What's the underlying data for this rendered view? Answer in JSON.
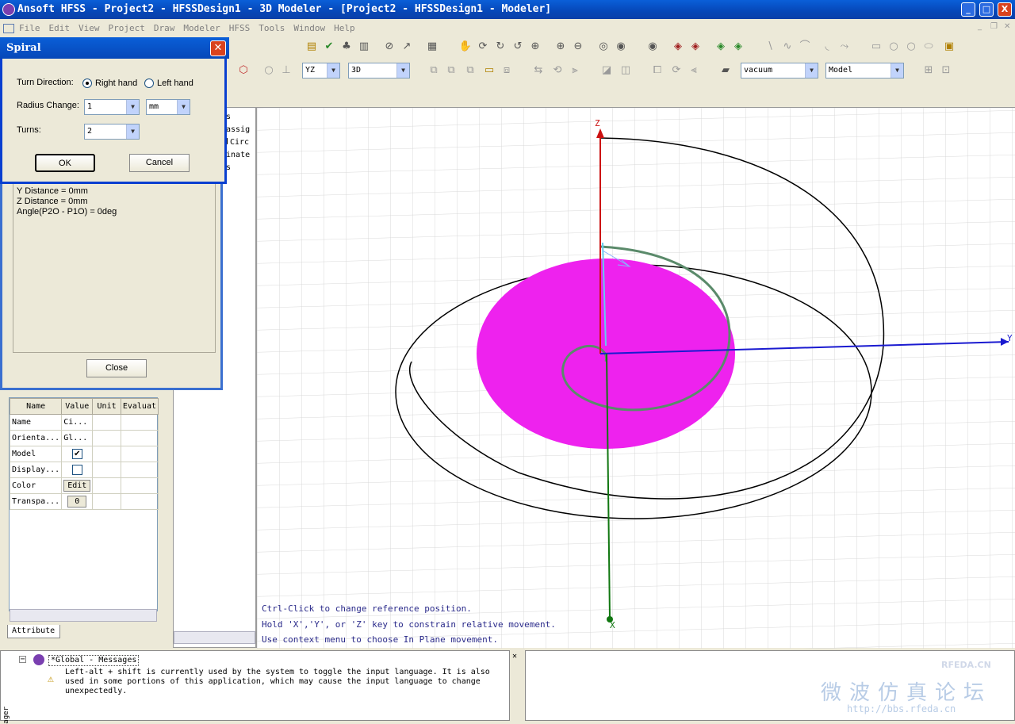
{
  "window": {
    "title": "Ansoft HFSS - Project2 - HFSSDesign1 - 3D Modeler - [Project2 - HFSSDesign1 - Modeler]",
    "minimize": "_",
    "maximize": "□",
    "close": "X"
  },
  "menu": [
    "File",
    "Edit",
    "View",
    "Project",
    "Draw",
    "Modeler",
    "HFSS",
    "Tools",
    "Window",
    "Help"
  ],
  "toolbar": {
    "plane": "YZ",
    "dimension": "3D",
    "material": "vacuum",
    "mode": "Model"
  },
  "spiral_dialog": {
    "title": "Spiral",
    "turn_direction_label": "Turn Direction:",
    "right_hand": "Right hand",
    "left_hand": "Left hand",
    "selected": "Right hand",
    "radius_change_label": "Radius Change:",
    "radius_change_value": "1",
    "radius_unit": "mm",
    "turns_label": "Turns:",
    "turns_value": "2",
    "ok": "OK",
    "cancel": "Cancel"
  },
  "measure_panel": {
    "lines": [
      "Y Distance = 0mm",
      "Z Distance = 0mm",
      "Angle(P2O - P1O) = 0deg"
    ],
    "close": "Close"
  },
  "tree": {
    "items": [
      "ts",
      "nassig",
      "Circ",
      "dinate",
      "es",
      "s"
    ]
  },
  "properties": {
    "headers": [
      "Name",
      "Value",
      "Unit",
      "Evaluat"
    ],
    "rows": [
      {
        "name": "Name",
        "value": "Ci...",
        "kind": "text"
      },
      {
        "name": "Orienta...",
        "value": "Gl...",
        "kind": "text"
      },
      {
        "name": "Model",
        "value": "✔",
        "kind": "check"
      },
      {
        "name": "Display...",
        "value": "",
        "kind": "check"
      },
      {
        "name": "Color",
        "value": "Edit",
        "kind": "button"
      },
      {
        "name": "Transpa...",
        "value": "0",
        "kind": "button"
      }
    ],
    "tab": "Attribute"
  },
  "viewport": {
    "hints": [
      "Ctrl-Click to change reference position.",
      "Hold 'X','Y', or 'Z' key to constrain relative movement.",
      "Use context menu to choose In Plane movement."
    ],
    "axis_z": "Z",
    "axis_y": "Y",
    "axis_x": "X",
    "colors": {
      "disk": "#ee22ee",
      "spiral": "#5a8a6a",
      "y_axis": "#1a1ad0",
      "z_axis": "#cc1111",
      "x_axis": "#117711"
    }
  },
  "messages": {
    "root": "*Global - Messages",
    "text": "Left-alt + shift is currently used by the system to toggle the input language. It is also\nused in some portions of this application, which may cause the input language to change\nunexpectedly.",
    "side_tab": "ager"
  },
  "watermark": {
    "cn": "微波仿真论坛",
    "url": "http://bbs.rfeda.cn",
    "brand": "RFEDA.CN"
  }
}
